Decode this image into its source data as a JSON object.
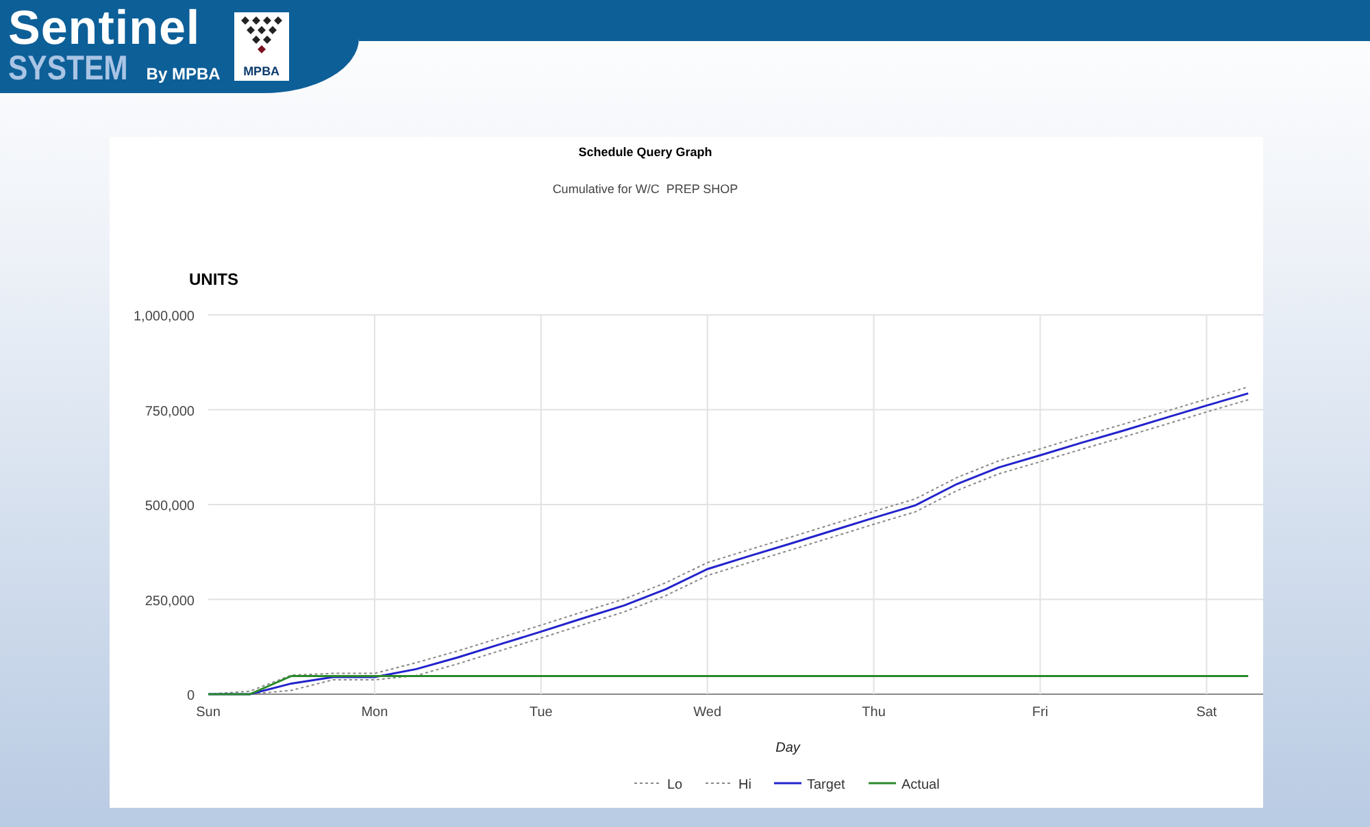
{
  "logo": {
    "title": "Sentinel",
    "subtitle": "SYSTEM",
    "byline": "By MPBA",
    "badge": "MPBA"
  },
  "chart": {
    "subtitle": "Cumulative for W/C  PREP SHOP",
    "chart_data": {
      "type": "line",
      "title": "Schedule Query Graph",
      "xlabel": "Day",
      "ylabel": "UNITS",
      "categories": [
        "Sun",
        null,
        null,
        null,
        "Mon",
        null,
        null,
        null,
        "Tue",
        null,
        null,
        null,
        "Wed",
        null,
        null,
        null,
        "Thu",
        null,
        null,
        null,
        "Fri",
        null,
        null,
        null,
        "Sat",
        null
      ],
      "series": [
        {
          "name": "Lo",
          "color": "#888888",
          "line_style": "dashed",
          "values": [
            0,
            0,
            10000,
            38000,
            38000,
            49000,
            80000,
            114000,
            148000,
            183000,
            217000,
            260000,
            313000,
            347000,
            380000,
            414000,
            448000,
            481000,
            537000,
            581000,
            613000,
            646000,
            678000,
            711000,
            744000,
            776000
          ]
        },
        {
          "name": "Hi",
          "color": "#888888",
          "line_style": "dashed",
          "values": [
            0,
            8000,
            50000,
            55000,
            55000,
            83000,
            114000,
            148000,
            182000,
            217000,
            251000,
            294000,
            347000,
            381000,
            414000,
            448000,
            482000,
            515000,
            571000,
            615000,
            647000,
            680000,
            712000,
            745000,
            778000,
            810000
          ]
        },
        {
          "name": "Target",
          "color": "#2222cc",
          "line_style": "solid",
          "values": [
            0,
            0,
            28000,
            45000,
            45000,
            66000,
            97000,
            131000,
            165000,
            200000,
            234000,
            277000,
            330000,
            364000,
            397000,
            431000,
            465000,
            498000,
            554000,
            598000,
            630000,
            663000,
            695000,
            728000,
            761000,
            793000
          ]
        },
        {
          "name": "Actual",
          "color": "#2a8a2a",
          "line_style": "solid",
          "values": [
            0,
            0,
            48000,
            48000,
            48000,
            48000,
            48000,
            48000,
            48000,
            48000,
            48000,
            48000,
            48000,
            48000,
            48000,
            48000,
            48000,
            48000,
            48000,
            48000,
            48000,
            48000,
            48000,
            48000,
            48000,
            48000
          ]
        }
      ],
      "ylim": [
        0,
        1000000
      ],
      "grid": true,
      "legend": "bottom",
      "yticks": [
        {
          "value": 0,
          "label": "0"
        },
        {
          "value": 250000,
          "label": "250,000"
        },
        {
          "value": 500000,
          "label": "500,000"
        },
        {
          "value": 750000,
          "label": "750,000"
        },
        {
          "value": 1000000,
          "label": "1,000,000"
        }
      ]
    }
  }
}
